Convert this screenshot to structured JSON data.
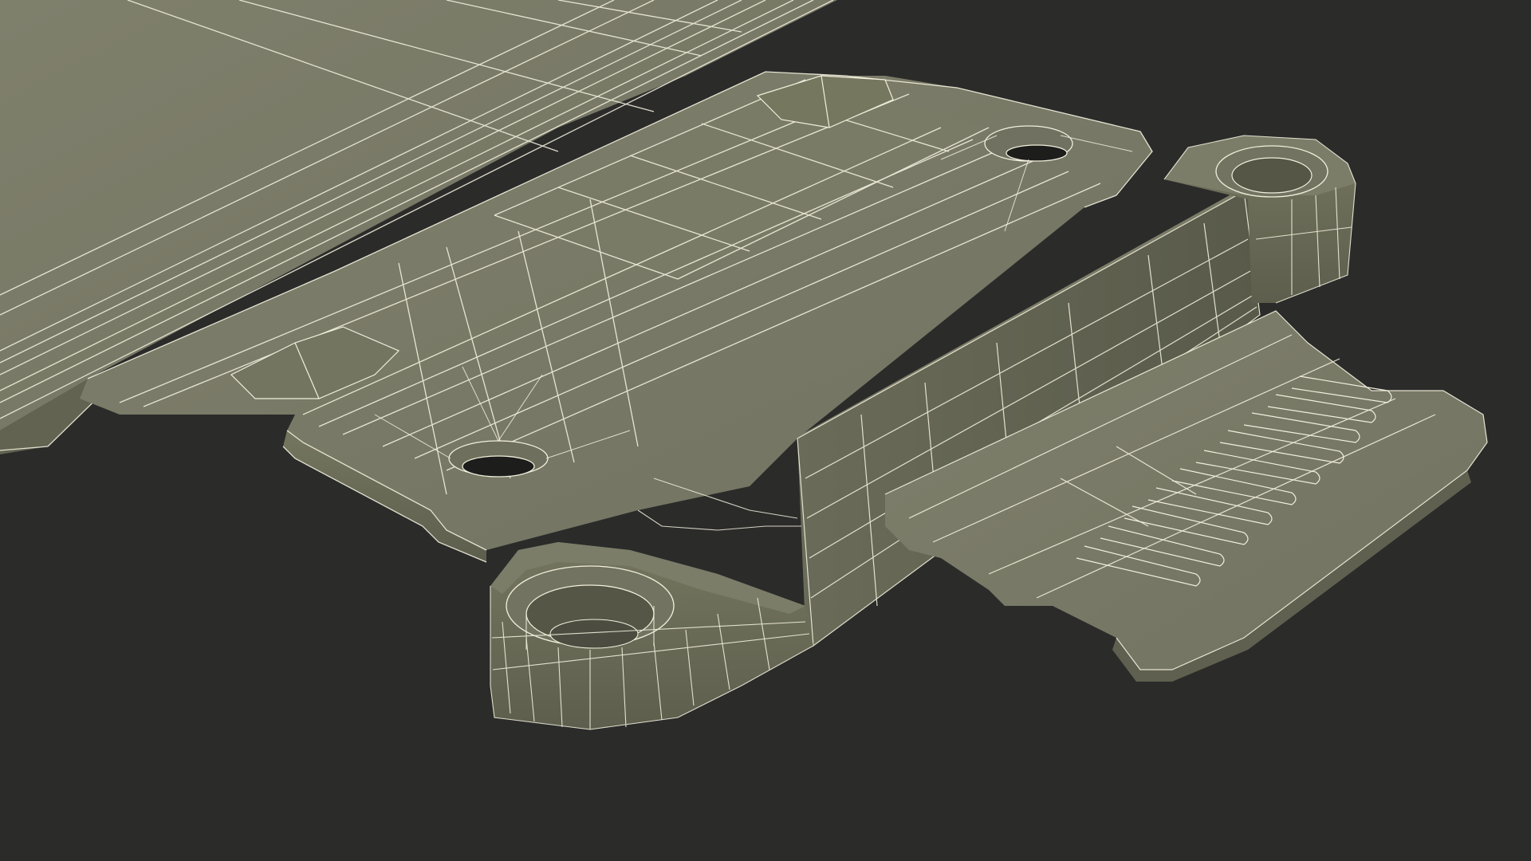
{
  "scene": {
    "subject": "wireframe-render",
    "colors": {
      "background": "#2b2b2a",
      "surface_top": "#7d7e6b",
      "surface_mid": "#747562",
      "surface_dark": "#5f604f",
      "surface_shadow": "#4e4f41",
      "wire": "#f2efdd",
      "hole": "#1d1d1c"
    }
  }
}
